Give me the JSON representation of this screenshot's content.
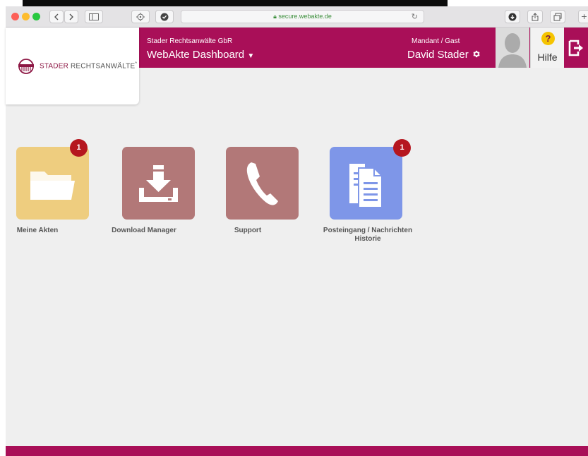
{
  "browser": {
    "url": "secure.webakte.de",
    "url_color": "#3c8f3c"
  },
  "header": {
    "company": "Stader Rechtsanwälte GbR",
    "title": "WebAkte Dashboard",
    "title_caret": "▼",
    "mandant": "Mandant / Gast",
    "user": "David Stader",
    "help_label": "Hilfe",
    "help_icon": "?",
    "brand_color": "#a90f58"
  },
  "logo": {
    "text_part1": "STADER",
    "text_part2": "RECHTSANWÄLTE",
    "mark": "*"
  },
  "tiles": [
    {
      "label": "Meine Akten",
      "badge": "1",
      "icon": "folder-icon",
      "color": "#eecd7f"
    },
    {
      "label": "Download Manager",
      "badge": "",
      "icon": "download-icon",
      "color": "#b27878"
    },
    {
      "label": "Support",
      "badge": "",
      "icon": "phone-icon",
      "color": "#b27878"
    },
    {
      "label": "Posteingang / Nachrichten Historie",
      "badge": "1",
      "icon": "documents-icon",
      "color": "#7e96e8"
    }
  ]
}
